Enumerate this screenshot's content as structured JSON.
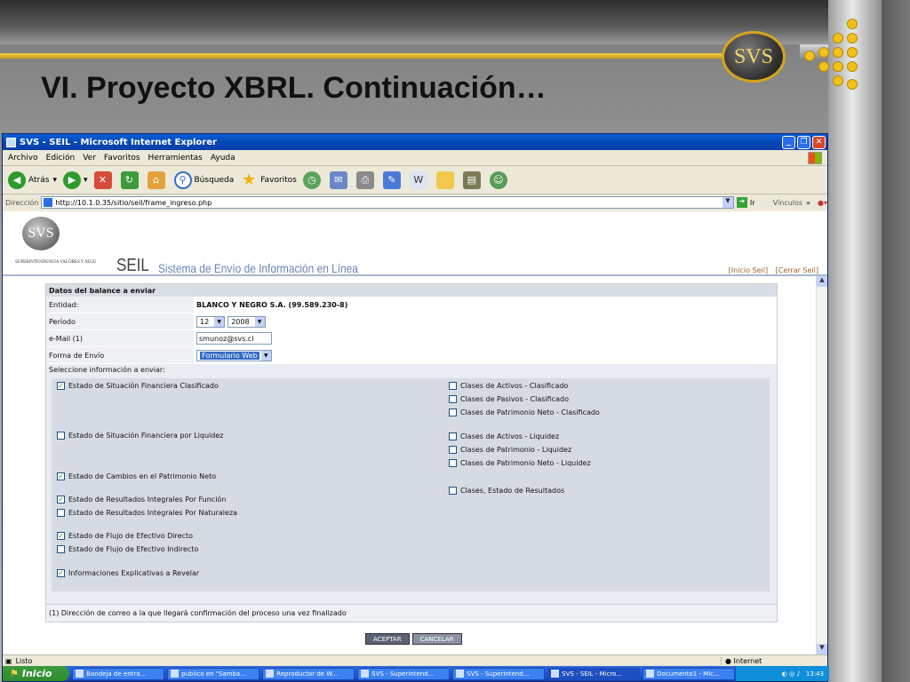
{
  "slide": {
    "title": "VI. Proyecto XBRL. Continuación…",
    "logo_text": "SVS",
    "accent_color": "#e9b913"
  },
  "window": {
    "title": "SVS - SEIL - Microsoft Internet Explorer",
    "menu": [
      "Archivo",
      "Edición",
      "Ver",
      "Favoritos",
      "Herramientas",
      "Ayuda"
    ],
    "toolbar": {
      "back": "Atrás",
      "search": "Búsqueda",
      "favorites": "Favoritos"
    },
    "address_label": "Dirección",
    "url": "http://10.1.0.35/sitio/seil/frame_ingreso.php",
    "go_label": "Ir",
    "links_label": "Vínculos"
  },
  "seil": {
    "logo_text": "SVS",
    "org": "SUPERINTENDENCIA VALORES Y SEGU",
    "brand": "SEIL",
    "subtitle": "Sistema de Envío de Información en Línea",
    "link_home": "[Inicio Seil]",
    "link_close": "[Cerrar Seil]"
  },
  "form": {
    "header": "Datos del balance a enviar",
    "entity_label": "Entidad:",
    "entity_value": "BLANCO Y NEGRO S.A. (99.589.230-8)",
    "period_label": "Período",
    "period_month": "12",
    "period_year": "2008",
    "email_label": "e-Mail (1)",
    "email_value": "smunoz@svs.cl",
    "send_form_label": "Forma de Envío",
    "send_form_value": "Formulario Web",
    "select_label": "Seleccione información a enviar:",
    "left_options": [
      {
        "label": "Estado de Situación Financiera Clasificado",
        "checked": true
      },
      {
        "label": "Estado de Situación Financiera por Liquidez",
        "checked": false
      },
      {
        "label": "Estado de Cambios en el Patrimonio Neto",
        "checked": true
      },
      {
        "label": "Estado de Resultados Integrales Por Función",
        "checked": true
      },
      {
        "label": "Estado de Resultados Integrales Por Naturaleza",
        "checked": false
      },
      {
        "label": "Estado de Flujo de Efectivo Directo",
        "checked": true
      },
      {
        "label": "Estado de Flujo de Efectivo Indirecto",
        "checked": false
      },
      {
        "label": "Informaciones Explicativas a Revelar",
        "checked": true
      }
    ],
    "right_options": [
      {
        "label": "Clases de Activos - Clasificado",
        "checked": false
      },
      {
        "label": "Clases de Pasivos - Clasificado",
        "checked": false
      },
      {
        "label": "Clases de Patrimonio Neto - Clasificado",
        "checked": false
      },
      {
        "label": "Clases de Activos - Liquidez",
        "checked": false
      },
      {
        "label": "Clases de Patrimonio - Liquidez",
        "checked": false
      },
      {
        "label": "Clases de Patrimonio Neto - Liquidez",
        "checked": false
      },
      {
        "label": "Clases, Estado de Resultados",
        "checked": false
      }
    ],
    "footnote": "(1) Dirección de correo a la que llegará confirmación del proceso una vez finalizado",
    "accept_label": "ACEPTAR",
    "cancel_label": "CANCELAR"
  },
  "status": {
    "text": "Listo",
    "zone": "Internet"
  },
  "taskbar": {
    "start": "Inicio",
    "tasks": [
      "Bandeja de entra...",
      "publico en \"Samba...",
      "Reproductor de W...",
      "SVS - Superintend...",
      "SVS - Superintend...",
      "SVS - SEIL - Micro...",
      "Documento1 - Mic..."
    ],
    "active_task": 5,
    "clock": "13:43"
  }
}
